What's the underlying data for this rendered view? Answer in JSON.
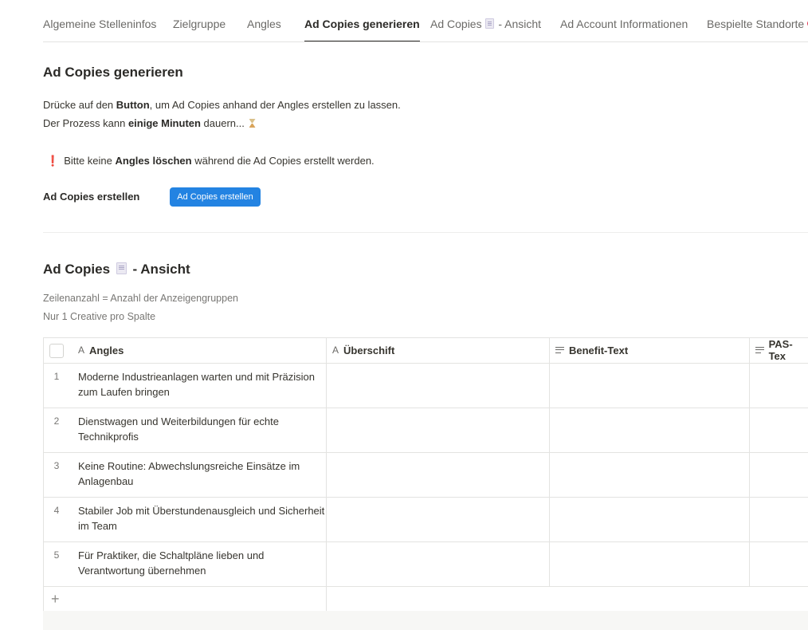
{
  "tabs": [
    {
      "label": "Algemeine Stelleninfos",
      "active": false
    },
    {
      "label": "Zielgruppe",
      "active": false
    },
    {
      "label": "Angles",
      "active": false
    },
    {
      "label": "Ad Copies generieren",
      "active": true
    },
    {
      "label_before": "Ad Copies",
      "icon": "document-icon",
      "label_after": "- Ansicht",
      "active": false
    },
    {
      "label": "Ad Account Informationen",
      "active": false
    },
    {
      "label": "Bespielte Standorte",
      "icon": "pin-icon",
      "active": false
    }
  ],
  "generate": {
    "title": "Ad Copies generieren",
    "line1_a": "Drücke auf den ",
    "line1_bold": "Button",
    "line1_b": ", um Ad Copies anhand der Angles erstellen zu lassen.",
    "line2_a": "Der Prozess kann ",
    "line2_bold": "einige Minuten",
    "line2_b": " dauern...",
    "line2_icon": "hourglass-icon",
    "warning_mark": "❗",
    "warning_a": "Bitte keine ",
    "warning_bold": "Angles löschen",
    "warning_b": " während die Ad Copies erstellt werden.",
    "button_row_label": "Ad Copies erstellen",
    "button_label": "Ad Copies erstellen"
  },
  "view": {
    "title_before": "Ad Copies",
    "title_icon": "document-icon",
    "title_after": "- Ansicht",
    "note1": "Zeilenanzahl = Anzahl der Anzeigengruppen",
    "note2": "Nur 1 Creative pro Spalte"
  },
  "table": {
    "columns": [
      {
        "label": "Angles",
        "icon": "title-icon"
      },
      {
        "label": "Überschift",
        "icon": "title-icon"
      },
      {
        "label": "Benefit-Text",
        "icon": "text-icon"
      },
      {
        "label": "PAS-Tex",
        "icon": "text-icon"
      }
    ],
    "rows": [
      {
        "num": "1",
        "angle": "Moderne Industrieanlagen warten und mit Präzision zum Laufen bringen"
      },
      {
        "num": "2",
        "angle": "Dienstwagen und Weiterbildungen für echte Technikprofis"
      },
      {
        "num": "3",
        "angle": "Keine Routine: Abwechslungsreiche Einsätze im Anlagenbau"
      },
      {
        "num": "4",
        "angle": "Stabiler Job mit Überstundenausgleich und Sicherheit im Team"
      },
      {
        "num": "5",
        "angle": "Für Praktiker, die Schaltpläne lieben und Verantwortung übernehmen"
      }
    ],
    "add_row": "+"
  },
  "colors": {
    "accent": "#2383e2",
    "warning": "#e03e3e"
  }
}
